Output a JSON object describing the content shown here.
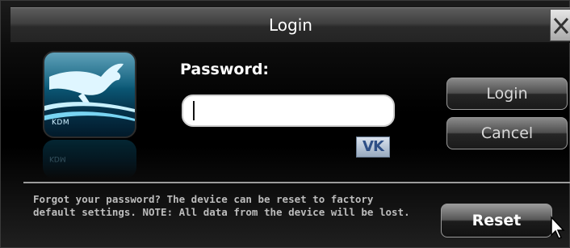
{
  "window": {
    "title": "Login"
  },
  "app_icon": {
    "label": "KDM"
  },
  "password": {
    "label": "Password:",
    "value": ""
  },
  "vk_button": {
    "label": "VK"
  },
  "buttons": {
    "login": "Login",
    "cancel": "Cancel",
    "reset": "Reset"
  },
  "footer": {
    "forgot_text": "Forgot your password? The device can be reset to factory default settings. NOTE: All data from the device will be lost."
  },
  "icons": {
    "close": "close-icon",
    "kangaroo": "kangaroo-logo-icon",
    "cursor": "mouse-pointer-icon"
  },
  "colors": {
    "title_bar": "#3f3f3f",
    "background": "#000000",
    "icon_blue": "#0b6e92",
    "vk_text": "#2e4f86"
  }
}
